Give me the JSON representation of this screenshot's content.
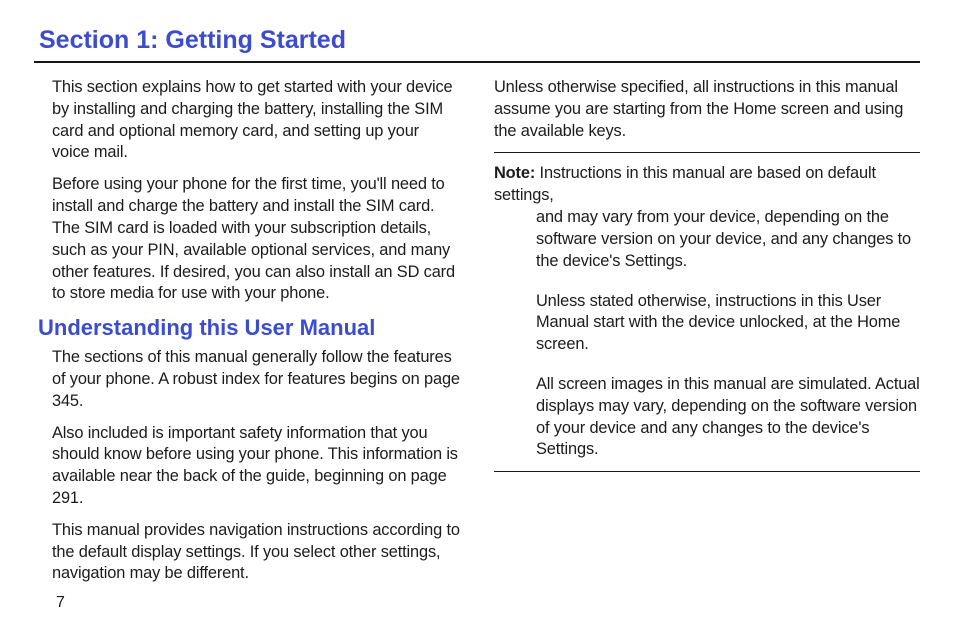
{
  "section_title": "Section 1: Getting Started",
  "left": {
    "p1": "This section explains how to get started with your device by installing and charging the battery, installing the SIM card and optional memory card, and setting up your voice mail.",
    "p2": "Before using your phone for the first time, you'll need to install and charge the battery and install the SIM card. The SIM card is loaded with your subscription details, such as your PIN, available optional services, and many other features. If desired, you can also install an SD card to store media for use with your phone.",
    "subhead": "Understanding this User Manual",
    "p3": "The sections of this manual generally follow the features of your phone. A robust index for features begins on page 345.",
    "p4": "Also included is important safety information that you should know before using your phone. This information is available near the back of the guide, beginning on page 291.",
    "p5": "This manual provides navigation instructions according to the default display settings. If you select other settings, navigation may be different."
  },
  "right": {
    "p1": "Unless otherwise specified, all instructions in this manual assume you are starting from the Home screen and using the available keys.",
    "note_label": "Note:",
    "note1_first": "Instructions in this manual are based on default settings,",
    "note1_rest": "and may vary from your device, depending on the software version on your device, and any changes to the device's Settings.",
    "note2": "Unless stated otherwise, instructions in this User Manual start with the device unlocked, at the Home screen.",
    "note3": "All screen images in this manual are simulated. Actual displays may vary, depending on the software version of your device and any changes to the device's Settings."
  },
  "page_number": "7"
}
